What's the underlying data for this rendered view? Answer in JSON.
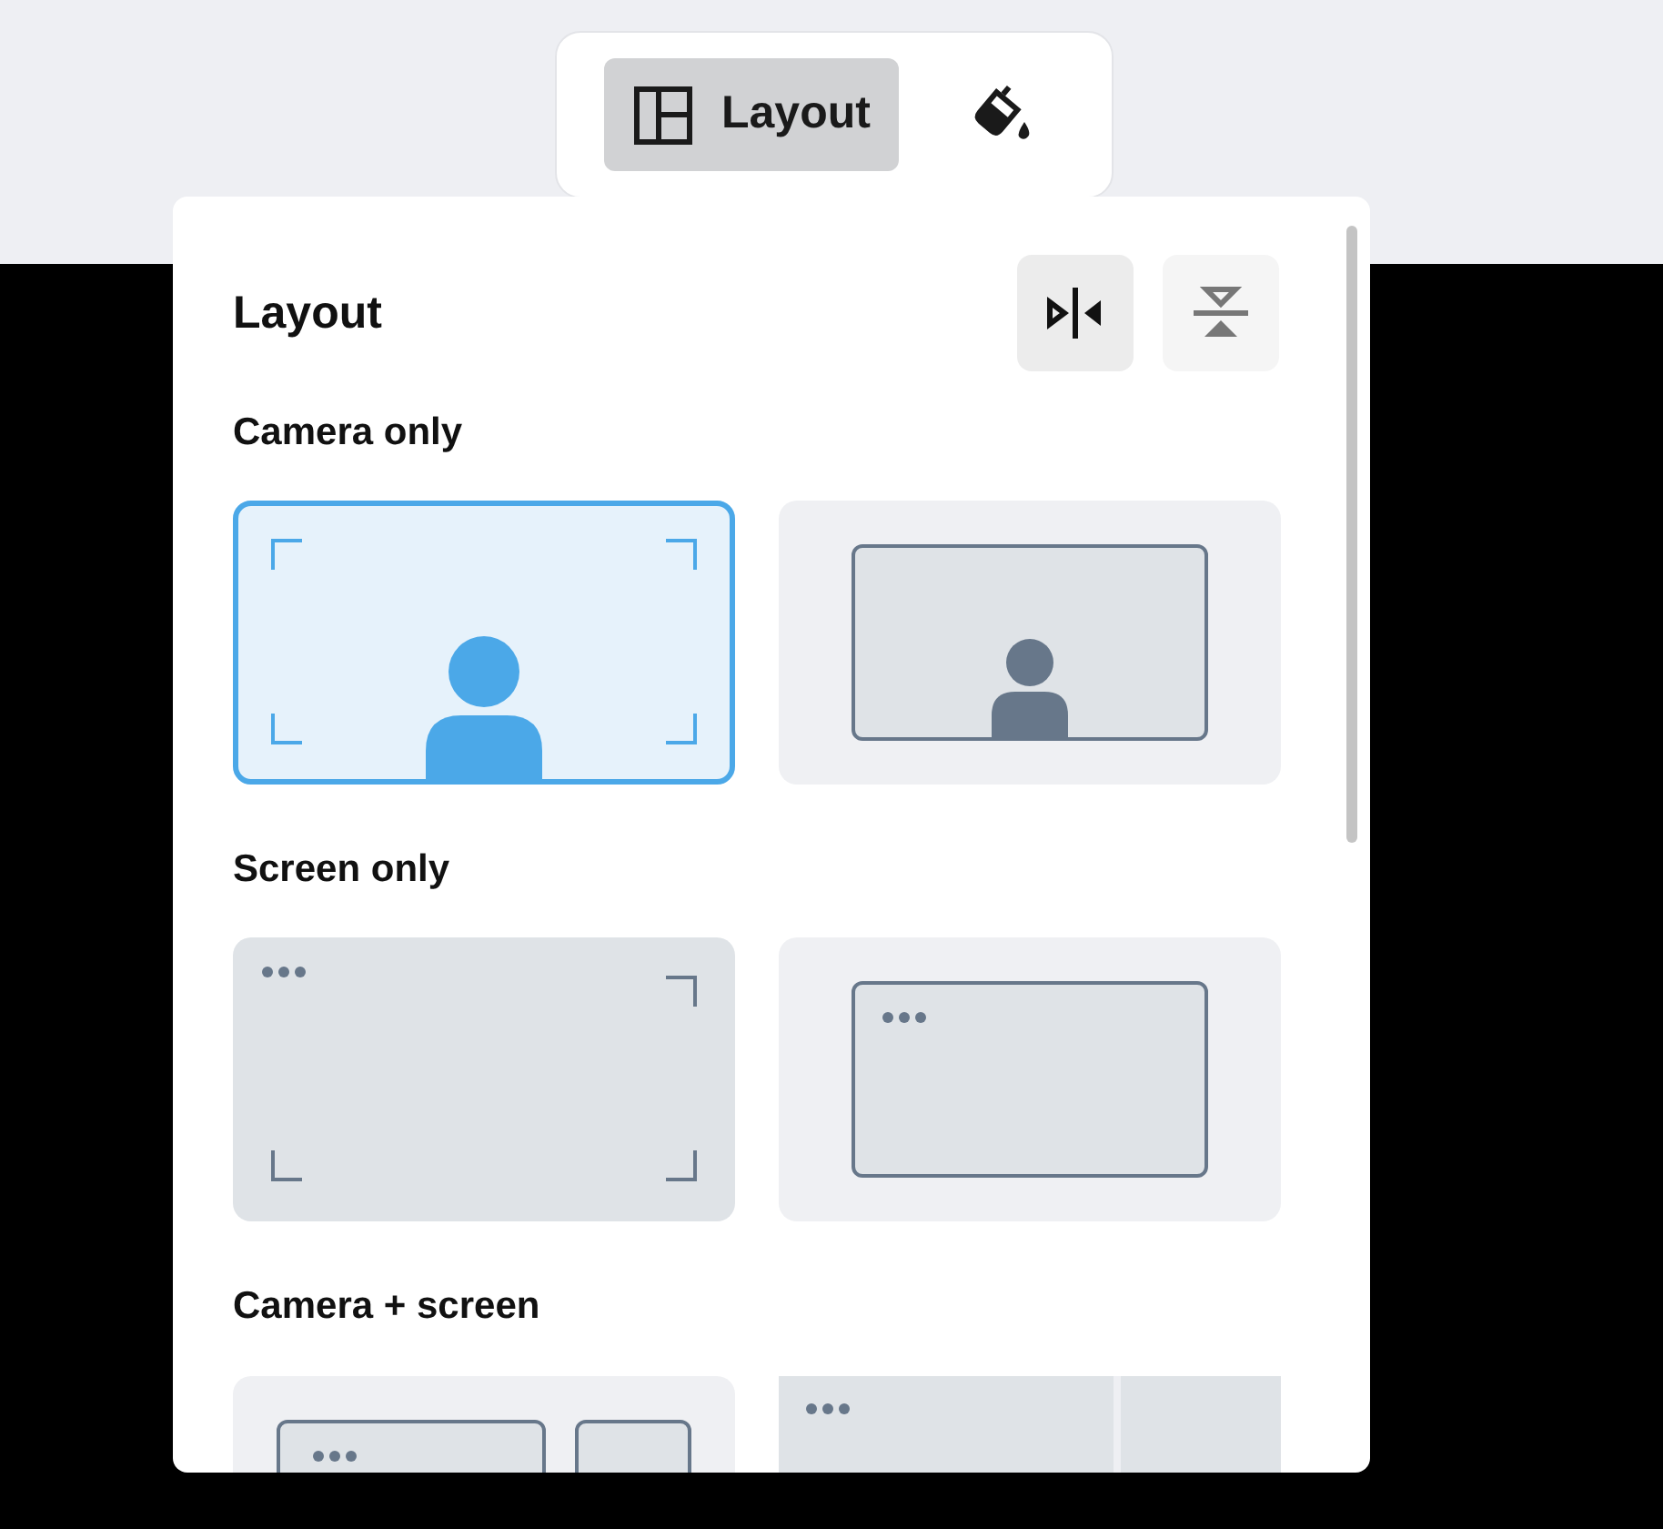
{
  "toolbar": {
    "items": [
      {
        "kind": "layout",
        "label": "Layout",
        "selected": true
      },
      {
        "kind": "theme",
        "selected": false
      }
    ]
  },
  "panel": {
    "title": "Layout",
    "modes": [
      {
        "kind": "side-by-side",
        "selected": true
      },
      {
        "kind": "stacked",
        "selected": false
      }
    ],
    "sections": [
      {
        "title": "Camera only",
        "options": [
          {
            "kind": "camera-full",
            "selected": true
          },
          {
            "kind": "camera-window",
            "selected": false
          }
        ]
      },
      {
        "title": "Screen only",
        "options": [
          {
            "kind": "screen-full",
            "selected": false
          },
          {
            "kind": "screen-window",
            "selected": false
          }
        ]
      },
      {
        "title": "Camera + screen",
        "options": [
          {
            "kind": "camera-screen-side",
            "selected": false
          },
          {
            "kind": "screen-split",
            "selected": false
          }
        ]
      }
    ]
  }
}
